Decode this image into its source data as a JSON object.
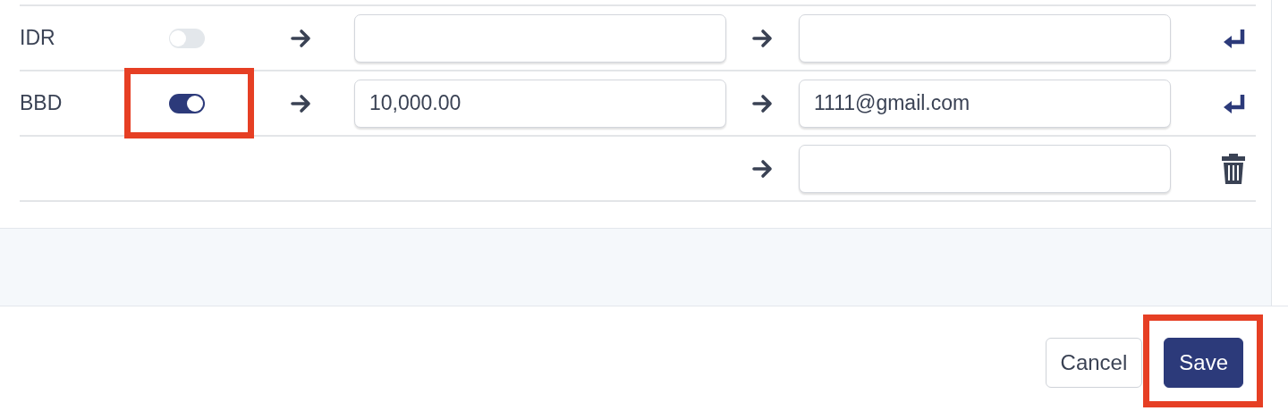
{
  "rows": [
    {
      "kind": "currency",
      "currency": "IDR",
      "enabled": false,
      "highlighted": false,
      "amount": "",
      "email": "",
      "action": {
        "kind": "enter"
      }
    },
    {
      "kind": "currency",
      "currency": "BBD",
      "enabled": true,
      "highlighted": true,
      "amount": "10,000.00",
      "email": "1111@gmail.com",
      "action": {
        "kind": "enter"
      }
    },
    {
      "kind": "extra",
      "email": "",
      "action": {
        "kind": "delete"
      }
    }
  ],
  "footer": {
    "buttons": [
      {
        "label": "Cancel",
        "kind": "secondary",
        "highlighted": false
      },
      {
        "label": "Save",
        "kind": "primary",
        "highlighted": true
      }
    ]
  }
}
